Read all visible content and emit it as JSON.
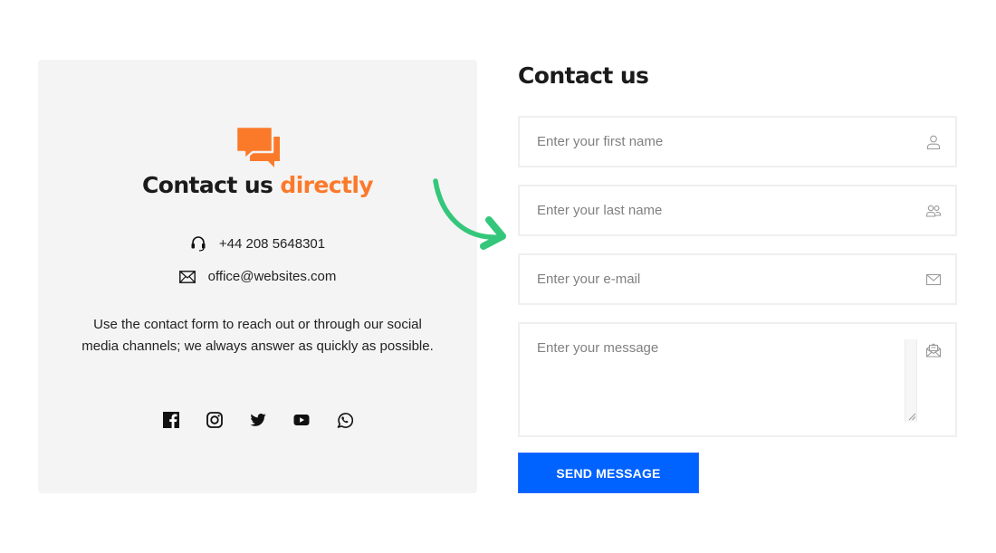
{
  "colors": {
    "accent": "#fb7a2a",
    "primary_button": "#0062ff",
    "arrow": "#34c77b",
    "card_bg": "#f4f4f4"
  },
  "card": {
    "icon": "chat-bubbles-icon",
    "title_main": "Contact us",
    "title_accent": "directly",
    "phone": {
      "icon": "headset-icon",
      "value": "+44 208 5648301"
    },
    "email": {
      "icon": "envelope-icon",
      "value": "office@websites.com"
    },
    "description": "Use the contact form to reach out or through our social media channels; we always answer as quickly as possible.",
    "socials": [
      {
        "name": "facebook",
        "icon": "facebook-icon"
      },
      {
        "name": "instagram",
        "icon": "instagram-icon"
      },
      {
        "name": "twitter",
        "icon": "twitter-icon"
      },
      {
        "name": "youtube",
        "icon": "youtube-icon"
      },
      {
        "name": "whatsapp",
        "icon": "whatsapp-icon"
      }
    ]
  },
  "form": {
    "title": "Contact us",
    "fields": {
      "first_name": {
        "placeholder": "Enter your first name",
        "value": "",
        "icon": "user-icon"
      },
      "last_name": {
        "placeholder": "Enter your last name",
        "value": "",
        "icon": "users-icon"
      },
      "email": {
        "placeholder": "Enter your e-mail",
        "value": "",
        "icon": "envelope-icon"
      },
      "message": {
        "placeholder": "Enter your message",
        "value": "",
        "icon": "open-envelope-icon"
      }
    },
    "submit_label": "SEND MESSAGE"
  }
}
